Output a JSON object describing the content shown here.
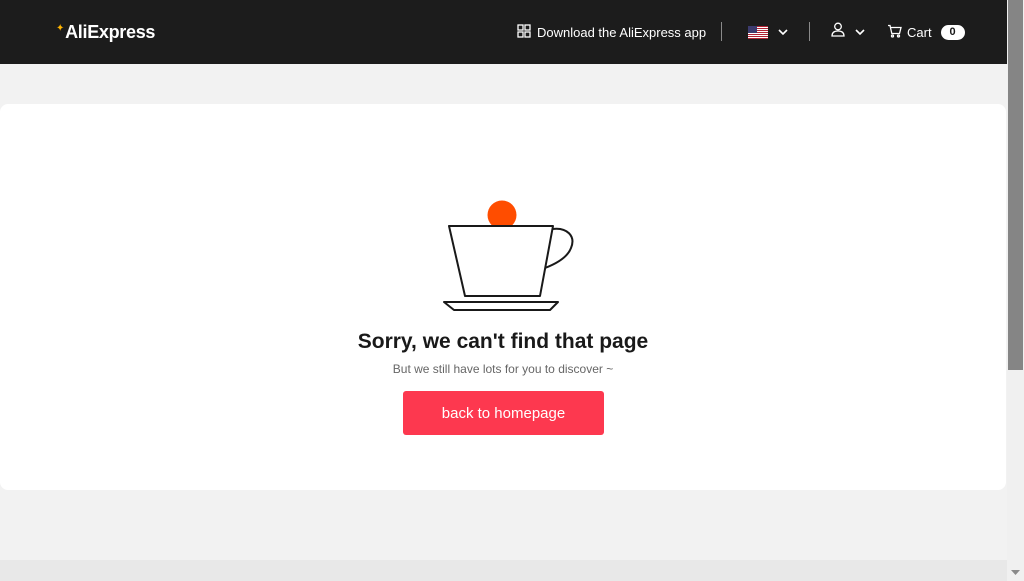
{
  "header": {
    "logo_text": "AliExpress",
    "app_link_label": "Download the AliExpress app",
    "cart_label": "Cart",
    "cart_count": "0",
    "icons": {
      "app": "qr-grid-icon",
      "flag": "us-flag-icon",
      "user": "user-icon",
      "cart": "cart-icon",
      "chevron": "chevron-down-icon"
    }
  },
  "main": {
    "illustration": "coffee-cup-icon",
    "title": "Sorry, we can't find that page",
    "subtitle": "But we still have lots for you to discover ~",
    "button_label": "back to homepage"
  },
  "colors": {
    "header_bg": "#1c1c1c",
    "page_bg": "#f2f2f2",
    "accent_button": "#fd384f",
    "cup_dot": "#ff4d00"
  }
}
